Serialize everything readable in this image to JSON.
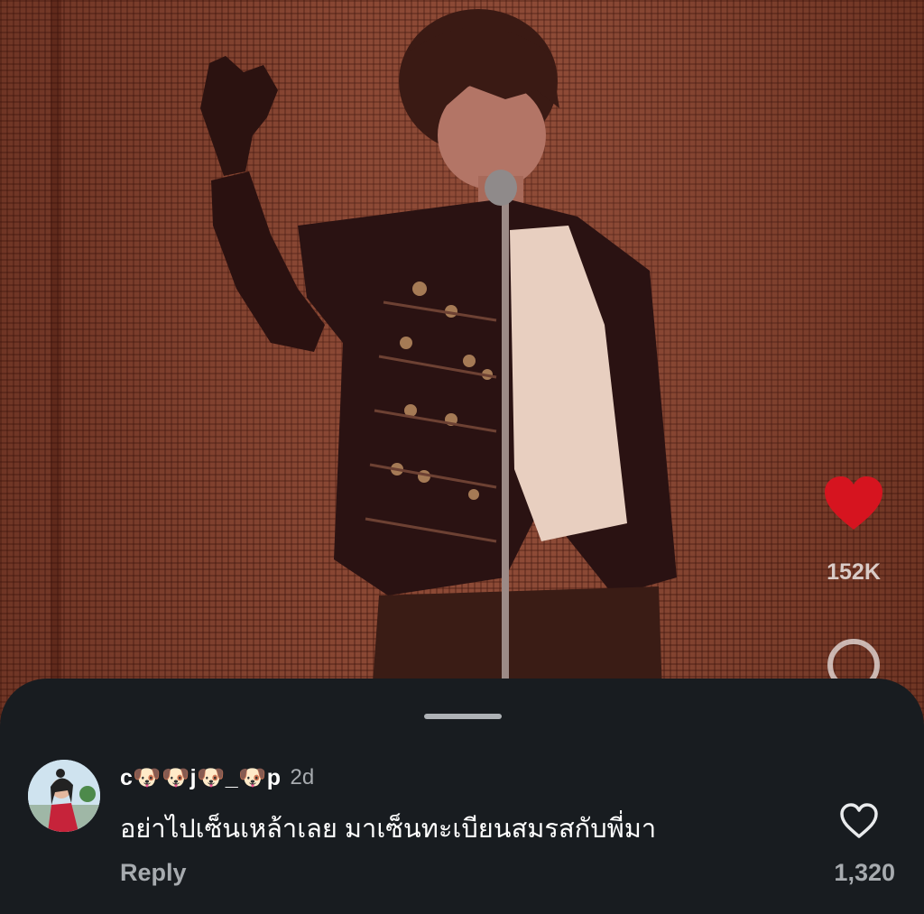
{
  "video": {
    "actions": {
      "like_icon": "heart-filled-icon",
      "like_color": "#d6141f",
      "like_count": "152K",
      "comment_icon": "comment-bubble-icon"
    }
  },
  "comments_sheet": {
    "background": "#181c20",
    "comment": {
      "avatar": "user-avatar",
      "username": "c🐶🐶j🐶_🐶p",
      "timestamp": "2d",
      "text": "อย่าไปเซ็นเหล้าเลย มาเซ็นทะเบียนสมรสกับพี่มา",
      "reply_label": "Reply",
      "like_icon": "heart-outline-icon",
      "like_count": "1,320"
    }
  }
}
